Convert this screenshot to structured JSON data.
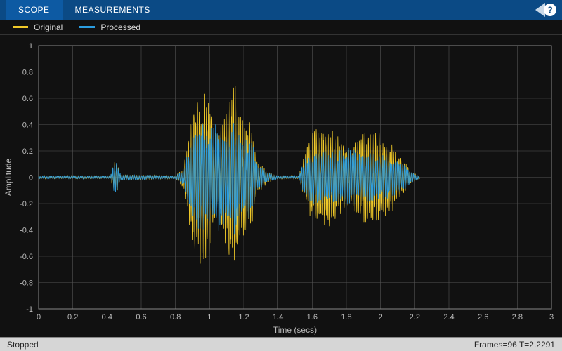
{
  "topbar": {
    "tab_scope": "SCOPE",
    "tab_measurements": "MEASUREMENTS",
    "help_label": "?"
  },
  "legend": {
    "items": [
      {
        "label": "Original",
        "color": "#f0c929"
      },
      {
        "label": "Processed",
        "color": "#2b9de0"
      }
    ]
  },
  "status": {
    "left": "Stopped",
    "right": "Frames=96  T=2.2291"
  },
  "chart_data": {
    "type": "line",
    "title": "",
    "xlabel": "Time (secs)",
    "ylabel": "Amplitude",
    "xlim": [
      0,
      3
    ],
    "ylim": [
      -1,
      1
    ],
    "xticks": [
      0,
      0.2,
      0.4,
      0.6,
      0.8,
      1.0,
      1.2,
      1.4,
      1.6,
      1.8,
      2.0,
      2.2,
      2.4,
      2.6,
      2.8,
      3.0
    ],
    "yticks": [
      -1,
      -0.8,
      -0.6,
      -0.4,
      -0.2,
      0,
      0.2,
      0.4,
      0.6,
      0.8,
      1
    ],
    "series": [
      {
        "name": "Original",
        "color": "#f0c929",
        "envelope": true
      },
      {
        "name": "Processed",
        "color": "#2b9de0",
        "envelope": true
      }
    ],
    "envelope": [
      {
        "t": 0.0,
        "orig": 0.01,
        "proc": 0.01
      },
      {
        "t": 0.05,
        "orig": 0.01,
        "proc": 0.01
      },
      {
        "t": 0.42,
        "orig": 0.01,
        "proc": 0.01
      },
      {
        "t": 0.45,
        "orig": 0.14,
        "proc": 0.14
      },
      {
        "t": 0.48,
        "orig": 0.02,
        "proc": 0.02
      },
      {
        "t": 0.8,
        "orig": 0.01,
        "proc": 0.01
      },
      {
        "t": 0.85,
        "orig": 0.08,
        "proc": 0.06
      },
      {
        "t": 0.88,
        "orig": 0.35,
        "proc": 0.22
      },
      {
        "t": 0.92,
        "orig": 0.6,
        "proc": 0.34
      },
      {
        "t": 0.96,
        "orig": 0.68,
        "proc": 0.4
      },
      {
        "t": 1.0,
        "orig": 0.55,
        "proc": 0.32
      },
      {
        "t": 1.05,
        "orig": 0.3,
        "proc": 0.4
      },
      {
        "t": 1.1,
        "orig": 0.55,
        "proc": 0.3
      },
      {
        "t": 1.14,
        "orig": 0.7,
        "proc": 0.45
      },
      {
        "t": 1.18,
        "orig": 0.45,
        "proc": 0.28
      },
      {
        "t": 1.24,
        "orig": 0.38,
        "proc": 0.3
      },
      {
        "t": 1.28,
        "orig": 0.12,
        "proc": 0.1
      },
      {
        "t": 1.34,
        "orig": 0.04,
        "proc": 0.03
      },
      {
        "t": 1.4,
        "orig": 0.01,
        "proc": 0.01
      },
      {
        "t": 1.52,
        "orig": 0.01,
        "proc": 0.01
      },
      {
        "t": 1.56,
        "orig": 0.18,
        "proc": 0.15
      },
      {
        "t": 1.6,
        "orig": 0.32,
        "proc": 0.18
      },
      {
        "t": 1.66,
        "orig": 0.38,
        "proc": 0.2
      },
      {
        "t": 1.72,
        "orig": 0.34,
        "proc": 0.18
      },
      {
        "t": 1.78,
        "orig": 0.24,
        "proc": 0.2
      },
      {
        "t": 1.82,
        "orig": 0.2,
        "proc": 0.22
      },
      {
        "t": 1.88,
        "orig": 0.28,
        "proc": 0.16
      },
      {
        "t": 1.92,
        "orig": 0.34,
        "proc": 0.18
      },
      {
        "t": 2.0,
        "orig": 0.32,
        "proc": 0.16
      },
      {
        "t": 2.06,
        "orig": 0.26,
        "proc": 0.14
      },
      {
        "t": 2.12,
        "orig": 0.14,
        "proc": 0.12
      },
      {
        "t": 2.18,
        "orig": 0.04,
        "proc": 0.04
      },
      {
        "t": 2.2291,
        "orig": 0.01,
        "proc": 0.01
      }
    ]
  }
}
